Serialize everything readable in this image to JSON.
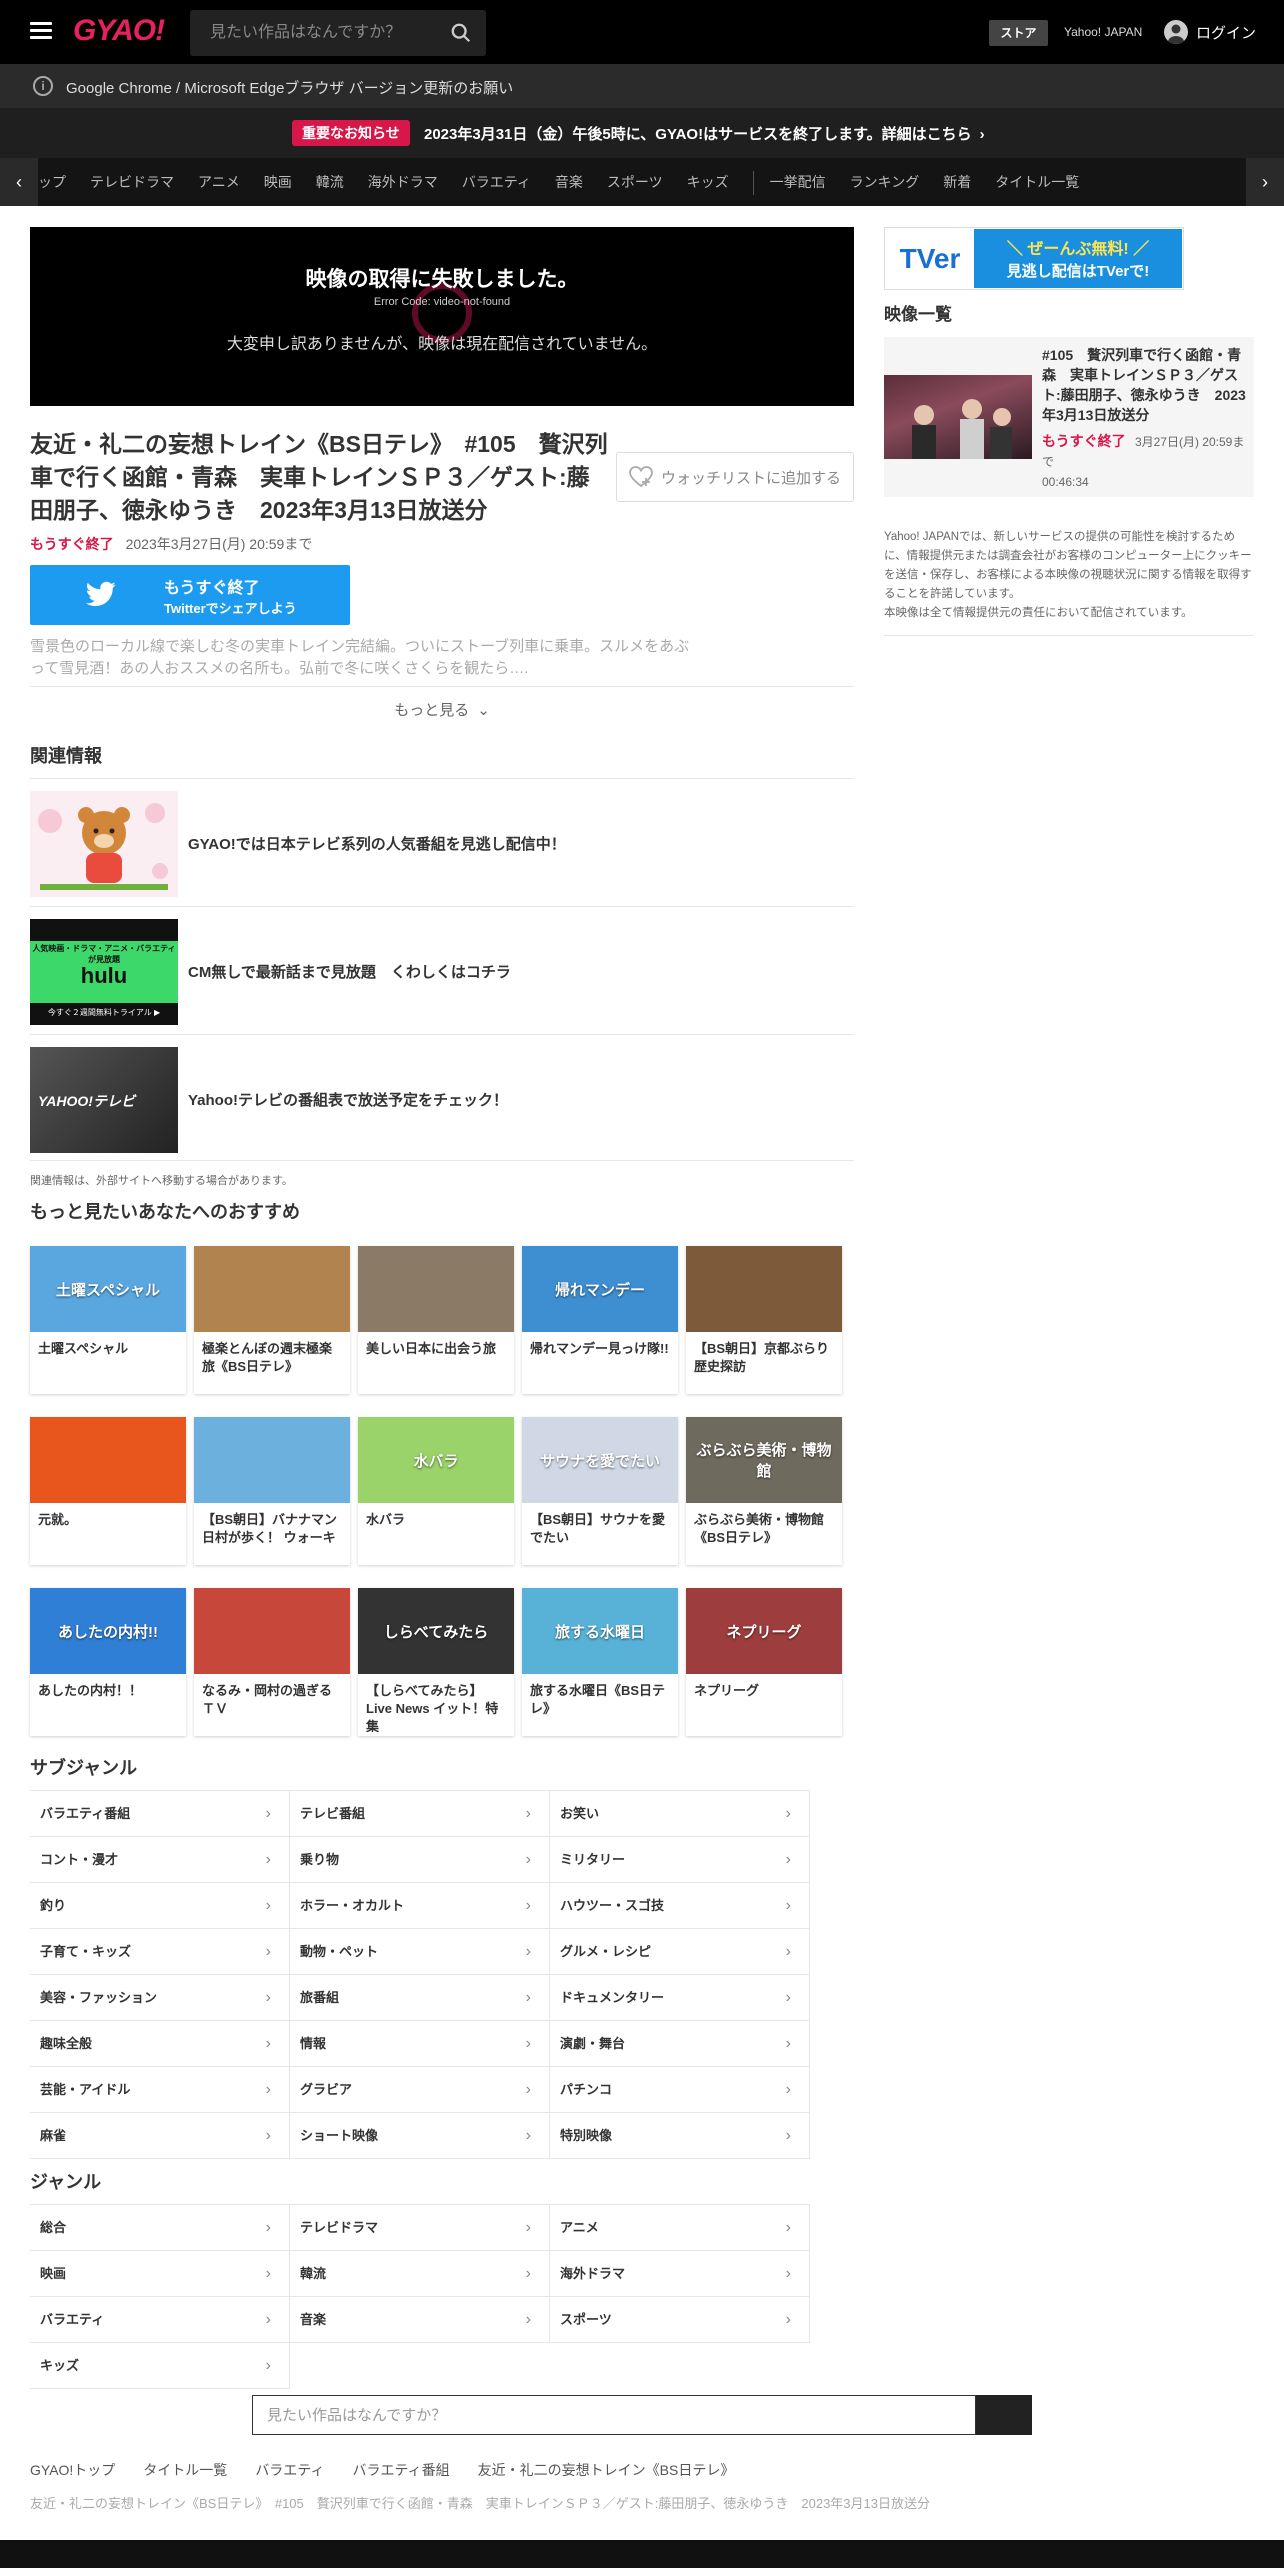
{
  "header": {
    "logo": "GYAO!",
    "search_placeholder": "見たい作品はなんですか？",
    "store": "ストア",
    "yahoo_japan": "Yahoo! JAPAN",
    "login": "ログイン"
  },
  "notice_browser": "Google Chrome / Microsoft Edgeブラウザ バージョン更新のお願い",
  "notice_important": {
    "badge": "重要なお知らせ",
    "text": "2023年3月31日（金）午後5時に、GYAO!はサービスを終了します。詳細はこちら"
  },
  "nav": {
    "items": [
      "ップ",
      "テレビドラマ",
      "アニメ",
      "映画",
      "韓流",
      "海外ドラマ",
      "バラエティ",
      "音楽",
      "スポーツ",
      "キッズ"
    ],
    "items2": [
      "一挙配信",
      "ランキング",
      "新着",
      "タイトル一覧"
    ]
  },
  "player": {
    "error_title": "映像の取得に失敗しました。",
    "error_code": "Error Code: video-not-found",
    "error_message": "大変申し訳ありませんが、映像は現在配信されていません。"
  },
  "video": {
    "title": "友近・礼二の妄想トレイン《BS日テレ》　#105　贅沢列車で行く函館・青森　実車トレインＳＰ３／ゲスト:藤田朋子、徳永ゆうき　2023年3月13日放送分",
    "watchlist": "ウォッチリストに追加する",
    "status": "もうすぐ終了",
    "until": "2023年3月27日(月) 20:59まで",
    "twitter_line1": "もうすぐ終了",
    "twitter_line2": "Twitterでシェアしよう",
    "description": "雪景色のローカル線で楽しむ冬の実車トレイン完結編。ついにストーブ列車に乗車。スルメをあぶって雪見酒！あの人おススメの名所も。弘前で冬に咲くさくらを観たら….",
    "more": "もっと見る"
  },
  "related": {
    "heading": "関連情報",
    "items": [
      {
        "text": "GYAO!では日本テレビ系列の人気番組を見逃し配信中！"
      },
      {
        "text": "CM無しで最新話まで見放題　くわしくはコチラ",
        "thumb_text1": "人気映画・ドラマ・アニメ・バラエティが見放題",
        "thumb_logo": "hulu",
        "thumb_text2": "今すぐ２週間無料トライアル ▶"
      },
      {
        "text": "Yahoo!テレビの番組表で放送予定をチェック！",
        "thumb_logo": "YAHOO!テレビ"
      }
    ],
    "note": "関連情報は、外部サイトへ移動する場合があります。"
  },
  "recommend": {
    "heading": "もっと見たいあなたへのおすすめ",
    "items": [
      {
        "title": "土曜スペシャル",
        "color": "#5aa7e0",
        "thumb_text": "土曜スペシャル"
      },
      {
        "title": "極楽とんぼの週末極楽旅《BS日テレ》",
        "color": "#b0834f"
      },
      {
        "title": "美しい日本に出会う旅",
        "color": "#8a7a66"
      },
      {
        "title": "帰れマンデー見っけ隊!!",
        "color": "#3d8fd2",
        "thumb_text": "帰れマンデー"
      },
      {
        "title": "【BS朝日】京都ぶらり歴史探訪",
        "color": "#7c5a3a"
      },
      {
        "title": "元就。",
        "color": "#e8561e"
      },
      {
        "title": "【BS朝日】バナナマン日村が歩く！ ウォーキ",
        "color": "#6cb0de"
      },
      {
        "title": "水バラ",
        "color": "#9ad36a",
        "thumb_text": "水バラ"
      },
      {
        "title": "【BS朝日】サウナを愛でたい",
        "color": "#cfd8e4",
        "thumb_text": "サウナを愛でたい"
      },
      {
        "title": "ぶらぶら美術・博物館《BS日テレ》",
        "color": "#6e6a5e",
        "thumb_text": "ぶらぶら美術・博物館"
      },
      {
        "title": "あしたの内村！！",
        "color": "#2f7fd6",
        "thumb_text": "あしたの内村!!"
      },
      {
        "title": "なるみ・岡村の過ぎるＴＶ",
        "color": "#c7473a"
      },
      {
        "title": "【しらべてみたら】Live News イット！特集",
        "color": "#333333",
        "thumb_text": "しらべてみたら"
      },
      {
        "title": "旅する水曜日《BS日テレ》",
        "color": "#58b2d8",
        "thumb_text": "旅する水曜日"
      },
      {
        "title": "ネプリーグ",
        "color": "#9d3d3d",
        "thumb_text": "ネプリーグ"
      }
    ]
  },
  "subgenre": {
    "heading": "サブジャンル",
    "items": [
      "バラエティ番組",
      "テレビ番組",
      "お笑い",
      "コント・漫才",
      "乗り物",
      "ミリタリー",
      "釣り",
      "ホラー・オカルト",
      "ハウツー・スゴ技",
      "子育て・キッズ",
      "動物・ペット",
      "グルメ・レシピ",
      "美容・ファッション",
      "旅番組",
      "ドキュメンタリー",
      "趣味全般",
      "情報",
      "演劇・舞台",
      "芸能・アイドル",
      "グラビア",
      "パチンコ",
      "麻雀",
      "ショート映像",
      "特別映像"
    ]
  },
  "genre": {
    "heading": "ジャンル",
    "items": [
      "総合",
      "テレビドラマ",
      "アニメ",
      "映画",
      "韓流",
      "海外ドラマ",
      "バラエティ",
      "音楽",
      "スポーツ",
      "キッズ"
    ]
  },
  "bottom_search_placeholder": "見たい作品はなんですか？",
  "breadcrumb": [
    "GYAO!トップ",
    "タイトル一覧",
    "バラエティ",
    "バラエティ番組",
    "友近・礼二の妄想トレイン《BS日テレ》"
  ],
  "breadcrumb_current": "友近・礼二の妄想トレイン《BS日テレ》　#105　贅沢列車で行く函館・青森　実車トレインＳＰ３／ゲスト:藤田朋子、徳永ゆうき　2023年3月13日放送分",
  "sidebar": {
    "tver_line1": "＼ ぜーんぶ無料! ／",
    "tver_line2": "見逃し配信はTVerで!",
    "tver_logo": "TVer",
    "video_list_heading": "映像一覧",
    "video_item": {
      "title": "#105　贅沢列車で行く函館・青森　実車トレインＳＰ３／ゲスト:藤田朋子、徳永ゆうき　2023年3月13日放送分",
      "status": "もうすぐ終了",
      "until": "3月27日(月) 20:59まで",
      "duration": "00:46:34"
    },
    "info_text": "Yahoo! JAPANでは、新しいサービスの提供の可能性を検討するために、情報提供元または調査会社がお客様のコンピューター上にクッキーを送信・保存し、お客様による本映像の視聴状況に関する情報を取得することを許諾しています。",
    "info_text2": "本映像は全て情報提供元の責任において配信されています。"
  },
  "colors": {
    "accent": "#e7215f",
    "status_red": "#d7174a",
    "twitter": "#1d9bf0"
  }
}
